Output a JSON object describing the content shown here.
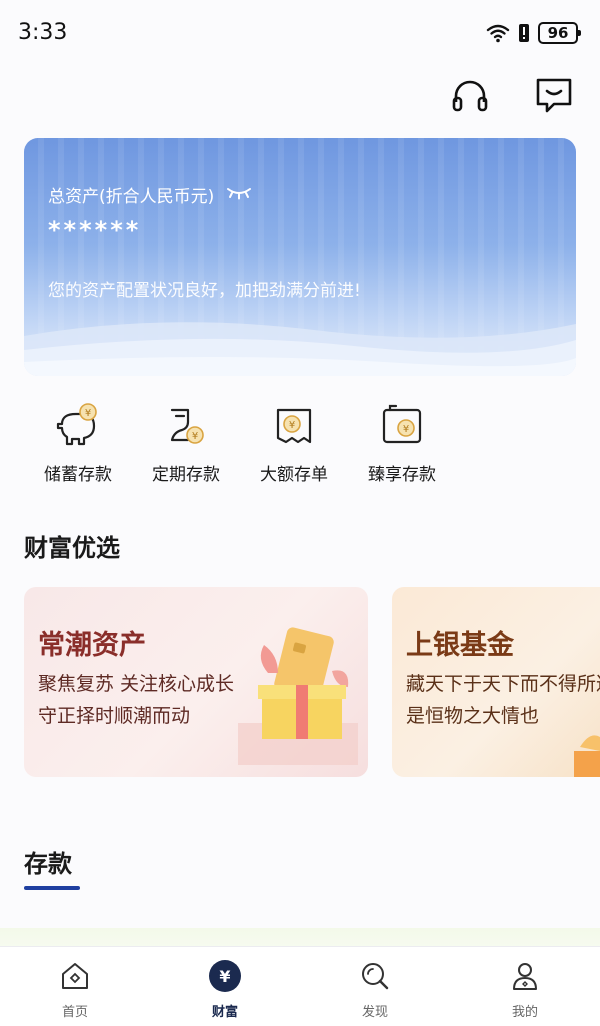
{
  "status_bar": {
    "time": "3:33",
    "battery": "96"
  },
  "asset_card": {
    "label": "总资产(折合人民币元)",
    "value": "******",
    "tip": "您的资产配置状况良好，加把劲满分前进!"
  },
  "quick_actions": [
    {
      "label": "储蓄存款",
      "icon": "piggy-bank-icon"
    },
    {
      "label": "定期存款",
      "icon": "fixed-deposit-icon"
    },
    {
      "label": "大额存单",
      "icon": "certificate-icon"
    },
    {
      "label": "臻享存款",
      "icon": "premium-deposit-icon"
    }
  ],
  "wealth_section": {
    "title": "财富优选"
  },
  "promos": [
    {
      "title": "常潮资产",
      "line1": "聚焦复苏 关注核心成长",
      "line2": "守正择时顺潮而动"
    },
    {
      "title": "上银基金",
      "line1": "藏天下于天下而不得所遁",
      "line2": "是恒物之大情也"
    }
  ],
  "deposit_tab": {
    "label": "存款"
  },
  "bottom_nav": [
    {
      "label": "首页",
      "icon": "home-icon",
      "active": false
    },
    {
      "label": "财富",
      "icon": "yuan-icon",
      "active": true
    },
    {
      "label": "发现",
      "icon": "discover-icon",
      "active": false
    },
    {
      "label": "我的",
      "icon": "profile-icon",
      "active": false
    }
  ],
  "colors": {
    "accent": "#1f3fa0",
    "nav_active": "#1b2a4f",
    "gold": "#d9a441"
  }
}
